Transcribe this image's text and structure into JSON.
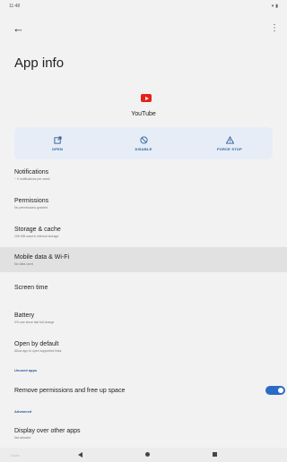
{
  "status_bar": {
    "time": "11:48",
    "icons": "▾ ▮"
  },
  "toolbar": {
    "back_glyph": "←",
    "menu_glyph": "⋮"
  },
  "page": {
    "title": "App info"
  },
  "app": {
    "name": "YouTube",
    "icon": "youtube-icon",
    "brand_color": "#e62117"
  },
  "actions": [
    {
      "label": "OPEN",
      "icon": "open-icon"
    },
    {
      "label": "DISABLE",
      "icon": "disable-icon"
    },
    {
      "label": "FORCE STOP",
      "icon": "warning-icon"
    }
  ],
  "rows": {
    "notifications": {
      "title": "Notifications",
      "subtitle": "~ 0 notifications per week"
    },
    "permissions": {
      "title": "Permissions",
      "subtitle": "No permissions granted"
    },
    "storage": {
      "title": "Storage & cache",
      "subtitle": "105 MB used in internal storage"
    },
    "mobile_data": {
      "title": "Mobile data & Wi-Fi",
      "subtitle": "No data used"
    },
    "screen_time": {
      "title": "Screen time"
    },
    "battery": {
      "title": "Battery",
      "subtitle": "0% use since last full charge"
    },
    "open_default": {
      "title": "Open by default",
      "subtitle": "Allow app to open supported links"
    },
    "remove_permissions": {
      "title": "Remove permissions and free up space",
      "toggle_on": true
    },
    "display_over": {
      "title": "Display over other apps",
      "subtitle": "Not allowed"
    }
  },
  "sections": {
    "unused_apps": "Unused apps",
    "advanced": "Advanced"
  },
  "colors": {
    "accent": "#2a5c9a",
    "toggle": "#2a6cc4",
    "background": "#f3f2f2"
  },
  "nav_bar": {
    "label": "Done"
  }
}
